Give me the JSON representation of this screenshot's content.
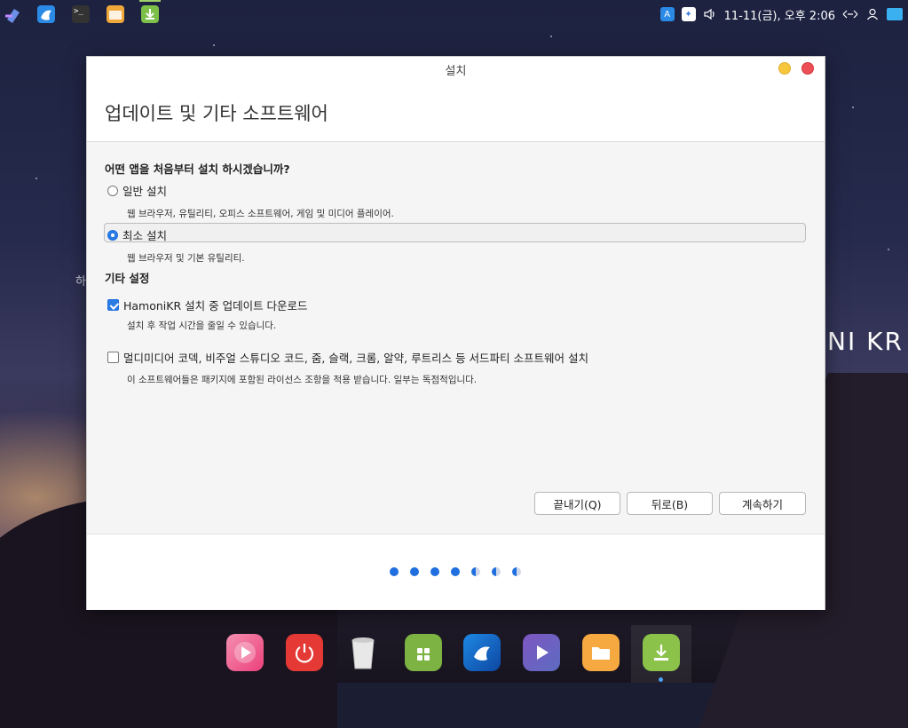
{
  "top_panel": {
    "apps": [
      {
        "name": "settings-app-icon",
        "color": "#5b7fdc"
      },
      {
        "name": "browser-app-icon",
        "color": "#2a8ae6"
      },
      {
        "name": "terminal-app-icon",
        "color": "#333"
      },
      {
        "name": "files-app-icon",
        "color": "#f0a83a"
      },
      {
        "name": "installer-app-icon",
        "color": "#7cc04a"
      }
    ],
    "terminal_glyph": ">_",
    "clock": "11-11(금), 오후 2:06"
  },
  "desktop": {
    "brand": "NI KR",
    "side_fragment": "하"
  },
  "window": {
    "title": "설치",
    "page_title": "업데이트 및 기타 소프트웨어",
    "question": "어떤 앱을 처음부터 설치 하시겠습니까?",
    "options": [
      {
        "label": "일반 설치",
        "description": "웹 브라우저, 유틸리티, 오피스  소프트웨어, 게임 및 미디어 플레이어.",
        "selected": false
      },
      {
        "label": "최소 설치",
        "description": "웹 브라우저 및 기본 유틸리티.",
        "selected": true
      }
    ],
    "other_settings_heading": "기타 설정",
    "checkboxes": [
      {
        "label": "HamoniKR 설치 중 업데이트 다운로드",
        "description": "설치 후 작업 시간을 줄일 수 있습니다.",
        "checked": true
      },
      {
        "label": "멀디미디어 코덱, 비주얼 스튜디오 코드, 줌, 슬랙, 크롬, 알약, 루트리스 등 서드파티 소프트웨어 설치",
        "description": "이 소프트웨어들은 패키지에 포함된 라이선스 조항을 적용 받습니다. 일부는 독점적입니다.",
        "checked": false
      }
    ],
    "buttons": {
      "quit": "끝내기(Q)",
      "back": "뒤로(B)",
      "continue": "계속하기"
    },
    "progress": {
      "total_steps": 7,
      "completed_steps": 4
    }
  },
  "dock": {
    "apps": [
      "media-player-icon",
      "power-icon",
      "trash-icon",
      "software-center-icon",
      "browser-icon",
      "video-player-icon",
      "files-icon",
      "installer-icon"
    ],
    "active_app": "installer-icon"
  }
}
